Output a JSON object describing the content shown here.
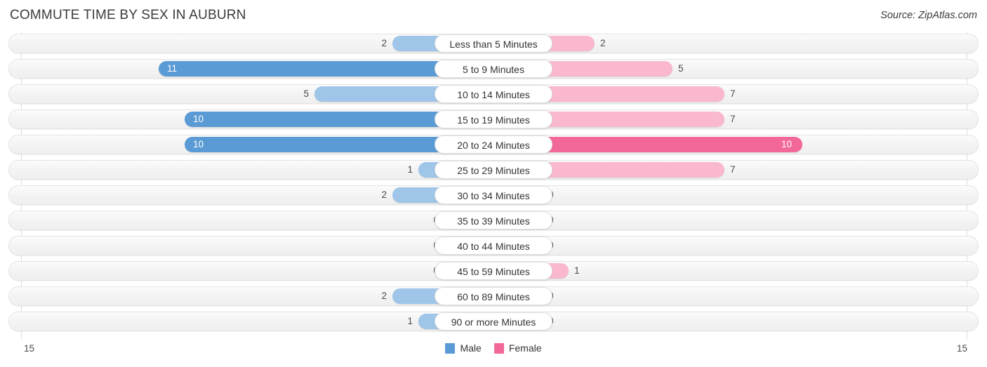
{
  "header": {
    "title": "COMMUTE TIME BY SEX IN AUBURN",
    "source": "Source: ZipAtlas.com"
  },
  "axis": {
    "left_label": "15",
    "right_label": "15",
    "max": 15
  },
  "legend": {
    "items": [
      {
        "label": "Male",
        "color": "#5b9bd5"
      },
      {
        "label": "Female",
        "color": "#f2689b"
      }
    ]
  },
  "colors": {
    "male_strong": "#5b9bd5",
    "male_light": "#9fc5e8",
    "female_strong": "#f2689b",
    "female_light": "#f9b8cd",
    "track": "#f3f3f3",
    "gridline": "#dcdcdc"
  },
  "chart_data": {
    "type": "bar",
    "orientation": "horizontal-diverging",
    "title": "COMMUTE TIME BY SEX IN AUBURN",
    "xlabel": "",
    "ylabel": "",
    "xlim": [
      15,
      15
    ],
    "grid": true,
    "legend_position": "bottom-center",
    "categories": [
      "Less than 5 Minutes",
      "5 to 9 Minutes",
      "10 to 14 Minutes",
      "15 to 19 Minutes",
      "20 to 24 Minutes",
      "25 to 29 Minutes",
      "30 to 34 Minutes",
      "35 to 39 Minutes",
      "40 to 44 Minutes",
      "45 to 59 Minutes",
      "60 to 89 Minutes",
      "90 or more Minutes"
    ],
    "series": [
      {
        "name": "Male",
        "values": [
          2,
          11,
          5,
          10,
          10,
          1,
          2,
          0,
          0,
          0,
          2,
          1
        ]
      },
      {
        "name": "Female",
        "values": [
          2,
          5,
          7,
          7,
          10,
          7,
          0,
          0,
          0,
          1,
          0,
          0
        ]
      }
    ]
  },
  "rows": [
    {
      "label": "Less than 5 Minutes",
      "male": "2",
      "female": "2",
      "male_inside": false,
      "female_inside": false
    },
    {
      "label": "5 to 9 Minutes",
      "male": "11",
      "female": "5",
      "male_inside": true,
      "female_inside": false
    },
    {
      "label": "10 to 14 Minutes",
      "male": "5",
      "female": "7",
      "male_inside": false,
      "female_inside": false
    },
    {
      "label": "15 to 19 Minutes",
      "male": "10",
      "female": "7",
      "male_inside": true,
      "female_inside": false
    },
    {
      "label": "20 to 24 Minutes",
      "male": "10",
      "female": "10",
      "male_inside": true,
      "female_inside": true
    },
    {
      "label": "25 to 29 Minutes",
      "male": "1",
      "female": "7",
      "male_inside": false,
      "female_inside": false
    },
    {
      "label": "30 to 34 Minutes",
      "male": "2",
      "female": "0",
      "male_inside": false,
      "female_inside": false
    },
    {
      "label": "35 to 39 Minutes",
      "male": "0",
      "female": "0",
      "male_inside": false,
      "female_inside": false
    },
    {
      "label": "40 to 44 Minutes",
      "male": "0",
      "female": "0",
      "male_inside": false,
      "female_inside": false
    },
    {
      "label": "45 to 59 Minutes",
      "male": "0",
      "female": "1",
      "male_inside": false,
      "female_inside": false
    },
    {
      "label": "60 to 89 Minutes",
      "male": "2",
      "female": "0",
      "male_inside": false,
      "female_inside": false
    },
    {
      "label": "90 or more Minutes",
      "male": "1",
      "female": "0",
      "male_inside": false,
      "female_inside": false
    }
  ]
}
